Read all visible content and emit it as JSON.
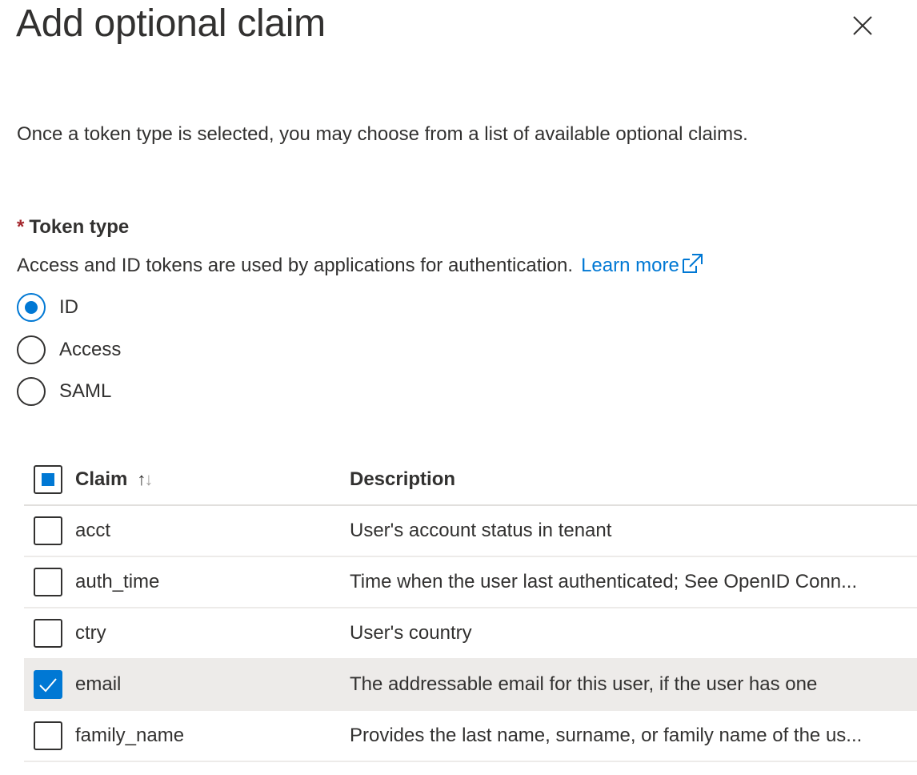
{
  "panel": {
    "title": "Add optional claim",
    "intro": "Once a token type is selected, you may choose from a list of available optional claims."
  },
  "token_type": {
    "required_marker": "*",
    "label": "Token type",
    "help_text": "Access and ID tokens are used by applications for authentication.",
    "learn_more": "Learn more",
    "options": [
      {
        "label": "ID",
        "selected": true
      },
      {
        "label": "Access",
        "selected": false
      },
      {
        "label": "SAML",
        "selected": false
      }
    ]
  },
  "claims_table": {
    "headers": {
      "claim": "Claim",
      "description": "Description",
      "sort_up": "↑",
      "sort_down": "↓"
    },
    "rows": [
      {
        "claim": "acct",
        "description": "User's account status in tenant",
        "checked": false
      },
      {
        "claim": "auth_time",
        "description": "Time when the user last authenticated; See OpenID Conn...",
        "checked": false
      },
      {
        "claim": "ctry",
        "description": "User's country",
        "checked": false
      },
      {
        "claim": "email",
        "description": "The addressable email for this user, if the user has one",
        "checked": true
      },
      {
        "claim": "family_name",
        "description": "Provides the last name, surname, or family name of the us...",
        "checked": false
      }
    ]
  },
  "colors": {
    "accent": "#0078d4",
    "required": "#a4262c",
    "selected_row": "#edebe9"
  }
}
